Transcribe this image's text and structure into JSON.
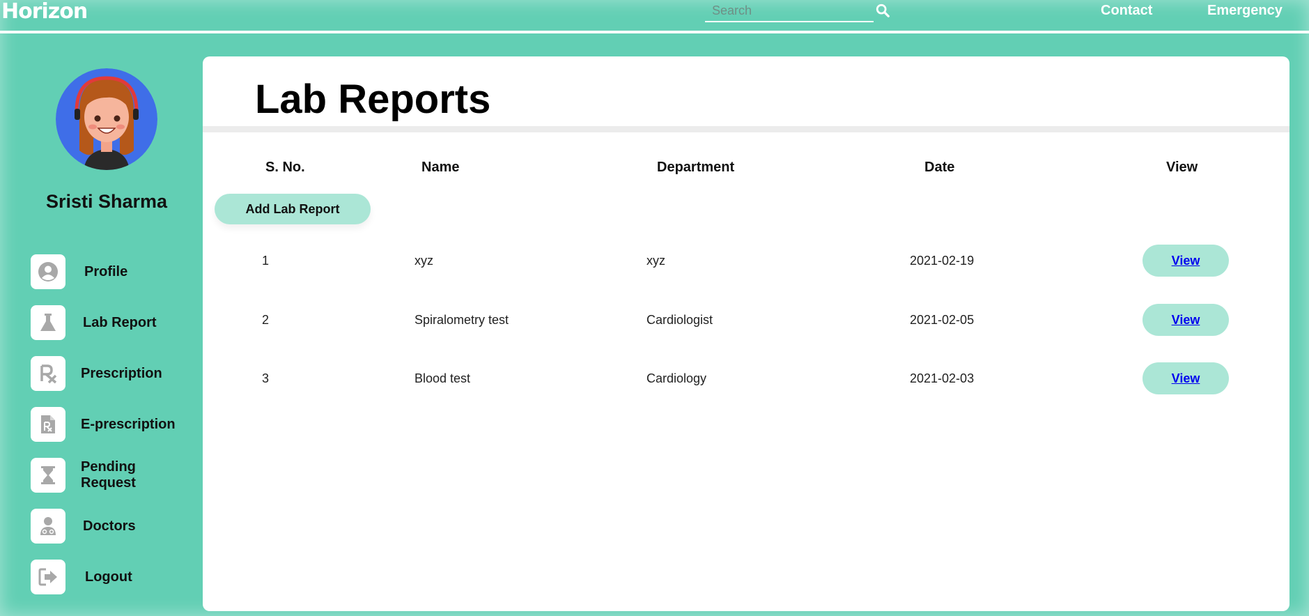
{
  "header": {
    "logo": "Horizon",
    "search_placeholder": "Search",
    "links": {
      "contact": "Contact",
      "emergency": "Emergency"
    }
  },
  "sidebar": {
    "user_name": "Sristi Sharma",
    "items": [
      {
        "label": "Profile",
        "icon": "user-circle-icon"
      },
      {
        "label": "Lab Report",
        "icon": "flask-icon"
      },
      {
        "label": "Prescription",
        "icon": "rx-icon"
      },
      {
        "label": "E-prescription",
        "icon": "rx-file-icon"
      },
      {
        "label": "Pending Request",
        "icon": "hourglass-icon"
      },
      {
        "label": "Doctors",
        "icon": "doctor-icon"
      },
      {
        "label": "Logout",
        "icon": "sign-out-icon"
      }
    ]
  },
  "main": {
    "title": "Lab Reports",
    "columns": [
      "S. No.",
      "Name",
      "Department",
      "Date",
      "View"
    ],
    "add_button": "Add Lab Report",
    "rows": [
      {
        "sno": "1",
        "name": "xyz",
        "department": "xyz",
        "date": "2021-02-19",
        "action": "View"
      },
      {
        "sno": "2",
        "name": "Spiralometry test",
        "department": "Cardiologist",
        "date": "2021-02-05",
        "action": "View"
      },
      {
        "sno": "3",
        "name": "Blood test",
        "department": "Cardiology",
        "date": "2021-02-03",
        "action": "View"
      }
    ]
  },
  "colors": {
    "background": "#62cfb4",
    "button": "#abe6d6",
    "icon_gray": "#a8a8a8",
    "link": "#0000ee"
  }
}
